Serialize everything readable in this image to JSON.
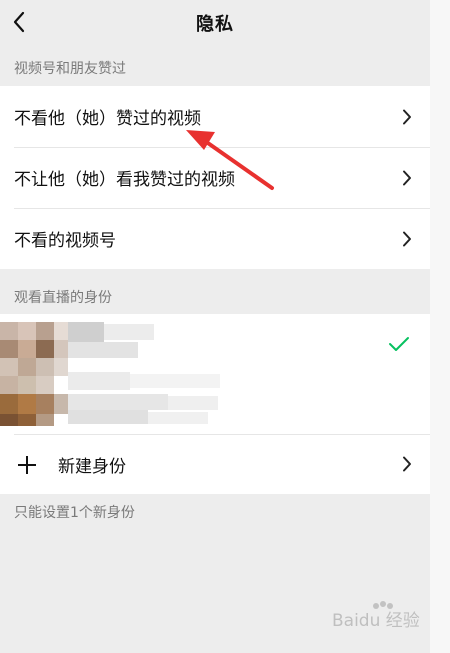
{
  "header": {
    "title": "隐私"
  },
  "sections": {
    "likes_label": "视频号和朋友赞过",
    "likes_items": [
      {
        "label": "不看他（她）赞过的视频"
      },
      {
        "label": "不让他（她）看我赞过的视频"
      },
      {
        "label": "不看的视频号"
      }
    ],
    "live_label": "观看直播的身份",
    "new_identity_label": "新建身份",
    "footnote": "只能设置1个新身份"
  },
  "watermark": {
    "text": "Baidu 经验"
  },
  "colors": {
    "background": "#ededed",
    "card": "#ffffff",
    "check": "#07c160",
    "annotation_arrow": "#e8312f"
  }
}
